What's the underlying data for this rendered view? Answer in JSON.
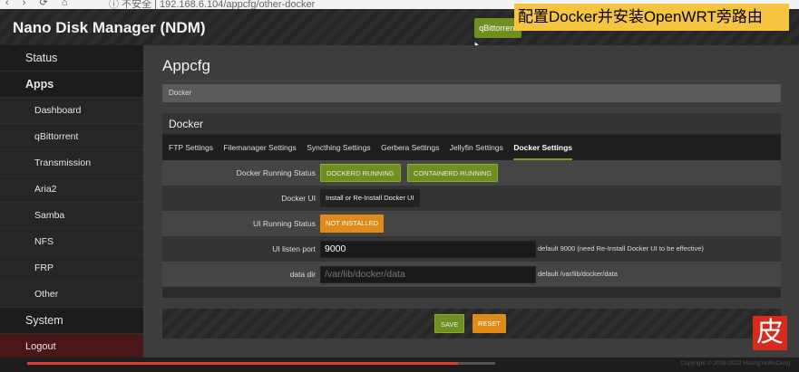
{
  "browser": {
    "nav_icons": "‹ › ⟳ ⌂",
    "url": "ⓘ 不安全 | 192.168.6.104/appcfg/other-docker"
  },
  "header": {
    "brand": "Nano Disk Manager (NDM)",
    "top_button": "qBittorrent"
  },
  "overlay_caption": "配置Docker并安装OpenWRT旁路由",
  "sidebar": {
    "items": [
      {
        "label": "Status",
        "kind": "top"
      },
      {
        "label": "Apps",
        "kind": "top-bold"
      },
      {
        "label": "Dashboard",
        "kind": "sub"
      },
      {
        "label": "qBittorrent",
        "kind": "sub"
      },
      {
        "label": "Transmission",
        "kind": "sub"
      },
      {
        "label": "Aria2",
        "kind": "sub"
      },
      {
        "label": "Samba",
        "kind": "sub"
      },
      {
        "label": "NFS",
        "kind": "sub"
      },
      {
        "label": "FRP",
        "kind": "sub"
      },
      {
        "label": "Other",
        "kind": "sub"
      },
      {
        "label": "System",
        "kind": "top"
      },
      {
        "label": "Logout",
        "kind": "logout"
      }
    ]
  },
  "main": {
    "title": "Appcfg",
    "breadcrumb": "Docker",
    "panel_title": "Docker",
    "tabs": [
      {
        "label": "FTP Settings",
        "active": false
      },
      {
        "label": "Filemanager Settings",
        "active": false
      },
      {
        "label": "Syncthing Settings",
        "active": false
      },
      {
        "label": "Gerbera Settings",
        "active": false
      },
      {
        "label": "Jellyfin Settings",
        "active": false
      },
      {
        "label": "Docker Settings",
        "active": true
      }
    ],
    "fields": {
      "running_status_label": "Docker Running Status",
      "dockerd_status": "DOCKERD RUNNING",
      "containerd_status": "CONTAINERD RUNNING",
      "docker_ui_label": "Docker UI",
      "install_button": "Install or Re-Install Docker UI",
      "ui_status_label": "UI Running Status",
      "ui_status": "NOT INSTALLED",
      "listen_port_label": "UI listen port",
      "listen_port_value": "9000",
      "listen_port_note": "default 9000 (need Re-Install Docker UI to be effective)",
      "data_dir_label": "data dir",
      "data_dir_placeholder": "/var/lib/docker/data",
      "data_dir_note": "default /var/lib/docker/data"
    },
    "actions": {
      "save": "SAVE",
      "reset": "RESET"
    }
  },
  "watermark_char": "皮",
  "footer": {
    "copyright": "Copyright © 2018-2022 HuangYeWuCeng",
    "video_progress": 0.92
  },
  "colors": {
    "green": "#6f8f1f",
    "orange": "#e08a1a",
    "overlay": "#f5c542",
    "stamp": "#d9281e"
  }
}
